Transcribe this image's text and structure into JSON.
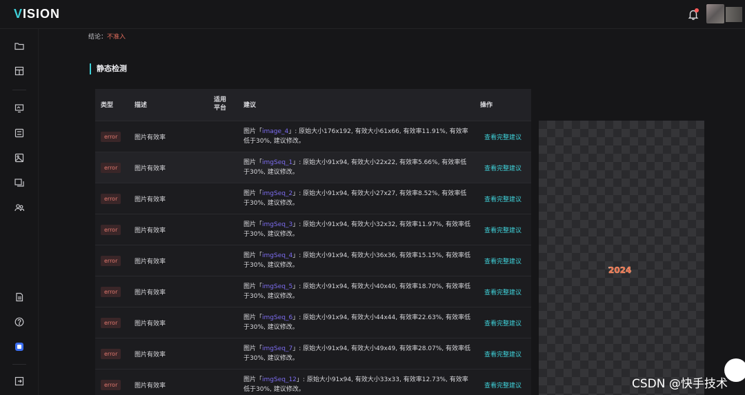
{
  "app": {
    "logo_v": "V",
    "logo_rest": "ISION"
  },
  "conclusion": {
    "label": "结论：",
    "value": "不准入"
  },
  "section": {
    "title": "静态检测"
  },
  "table": {
    "headers": {
      "type": "类型",
      "desc": "描述",
      "platform_1": "适用",
      "platform_2": "平台",
      "suggest": "建议",
      "op": "操作"
    },
    "rows": [
      {
        "type": "error",
        "desc": "图片有效率",
        "pre": "图片「",
        "name": "image_4",
        "post": "」: 原始大小176x192, 有效大小61x66, 有效率11.91%, 有效率低于30%, 建议修改。",
        "op": "查看完整建议"
      },
      {
        "type": "error",
        "desc": "图片有效率",
        "pre": "图片「",
        "name": "imgSeq_1",
        "post": "」: 原始大小91x94, 有效大小22x22, 有效率5.66%, 有效率低于30%, 建议修改。",
        "op": "查看完整建议"
      },
      {
        "type": "error",
        "desc": "图片有效率",
        "pre": "图片「",
        "name": "imgSeq_2",
        "post": "」: 原始大小91x94, 有效大小27x27, 有效率8.52%, 有效率低于30%, 建议修改。",
        "op": "查看完整建议"
      },
      {
        "type": "error",
        "desc": "图片有效率",
        "pre": "图片「",
        "name": "imgSeq_3",
        "post": "」: 原始大小91x94, 有效大小32x32, 有效率11.97%, 有效率低于30%, 建议修改。",
        "op": "查看完整建议"
      },
      {
        "type": "error",
        "desc": "图片有效率",
        "pre": "图片「",
        "name": "imgSeq_4",
        "post": "」: 原始大小91x94, 有效大小36x36, 有效率15.15%, 有效率低于30%, 建议修改。",
        "op": "查看完整建议"
      },
      {
        "type": "error",
        "desc": "图片有效率",
        "pre": "图片「",
        "name": "imgSeq_5",
        "post": "」: 原始大小91x94, 有效大小40x40, 有效率18.70%, 有效率低于30%, 建议修改。",
        "op": "查看完整建议"
      },
      {
        "type": "error",
        "desc": "图片有效率",
        "pre": "图片「",
        "name": "imgSeq_6",
        "post": "」: 原始大小91x94, 有效大小44x44, 有效率22.63%, 有效率低于30%, 建议修改。",
        "op": "查看完整建议"
      },
      {
        "type": "error",
        "desc": "图片有效率",
        "pre": "图片「",
        "name": "imgSeq_7",
        "post": "」: 原始大小91x94, 有效大小49x49, 有效率28.07%, 有效率低于30%, 建议修改。",
        "op": "查看完整建议"
      },
      {
        "type": "error",
        "desc": "图片有效率",
        "pre": "图片「",
        "name": "imgSeq_12",
        "post": "」: 原始大小91x94, 有效大小33x33, 有效率12.73%, 有效率低于30%, 建议修改。",
        "op": "查看完整建议"
      }
    ]
  },
  "preview": {
    "sticker_text": "2024"
  },
  "watermark": {
    "text": "CSDN @快手技术"
  },
  "colors": {
    "accent": "#3fd0d8",
    "error": "#e0786e",
    "link": "#7c6cf0",
    "background": "#161618"
  },
  "icons": {
    "sidebar": [
      "folder-icon",
      "layout-icon",
      "monitor-icon",
      "checklist-icon",
      "image-icon",
      "gallery-icon",
      "users-icon",
      "document-icon",
      "help-icon",
      "app-icon",
      "exit-icon"
    ],
    "topbar": [
      "bell-icon",
      "avatar"
    ]
  }
}
